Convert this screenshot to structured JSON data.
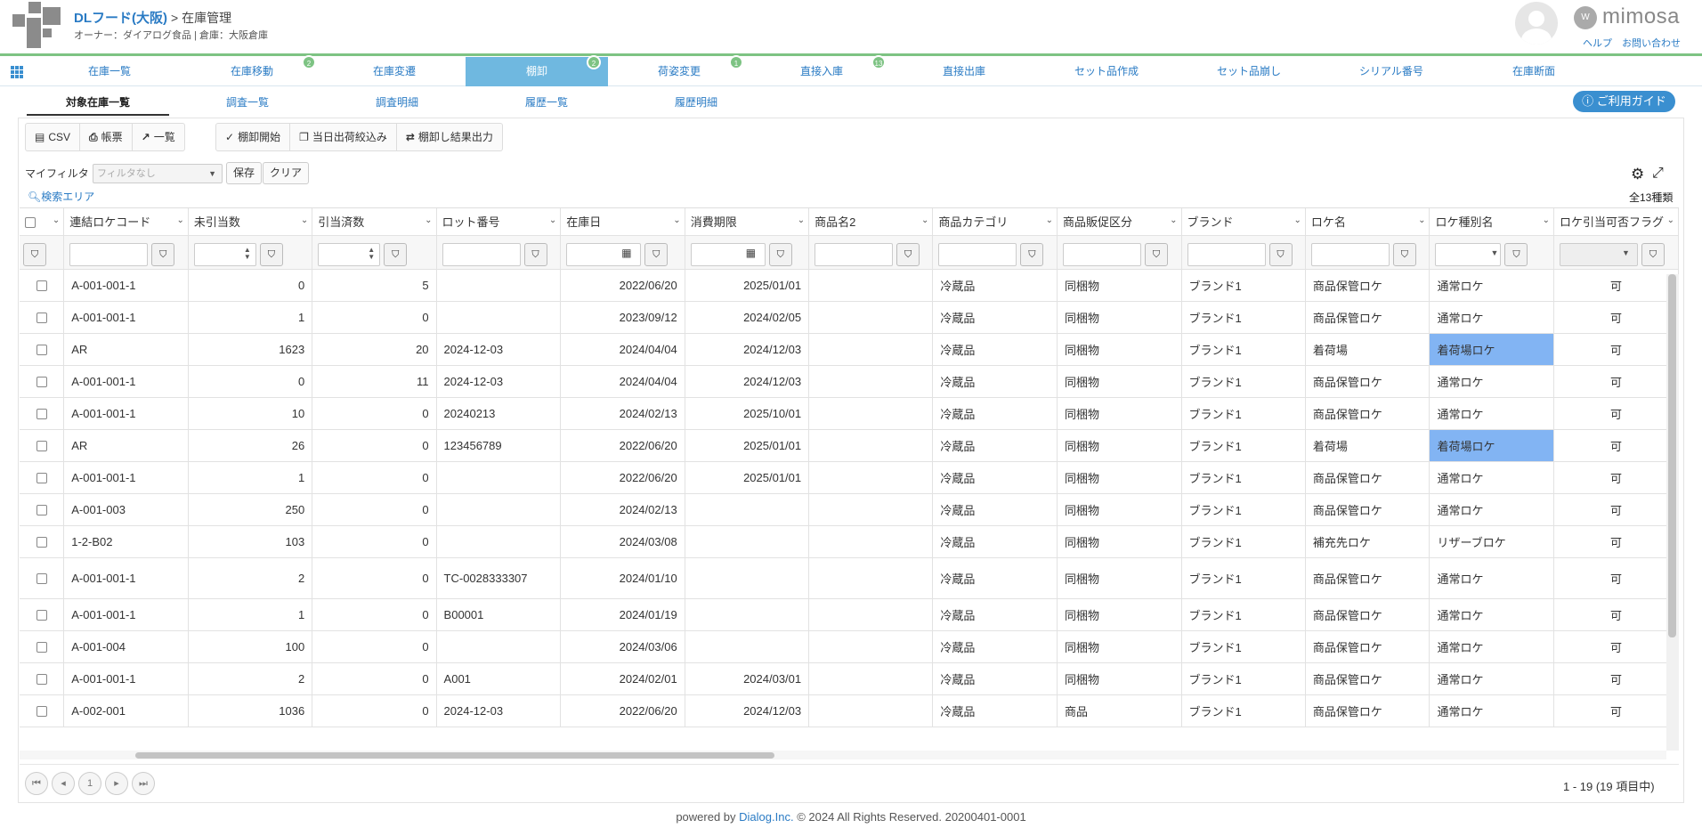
{
  "header": {
    "company": "DLフード(大阪)",
    "page": "> 在庫管理",
    "owner_line": "オーナー：ダイアログ食品 | 倉庫：大阪倉庫",
    "brand": "mimosa",
    "help": "ヘルプ",
    "contact": "お問い合わせ"
  },
  "nav": {
    "items": [
      {
        "label": "在庫一覧"
      },
      {
        "label": "在庫移動",
        "badge": "2"
      },
      {
        "label": "在庫変遷"
      },
      {
        "label": "棚卸",
        "badge": "2"
      },
      {
        "label": "荷姿変更",
        "badge": "1"
      },
      {
        "label": "直接入庫",
        "badge": "13"
      },
      {
        "label": "直接出庫"
      },
      {
        "label": "セット品作成"
      },
      {
        "label": "セット品崩し"
      },
      {
        "label": "シリアル番号"
      },
      {
        "label": "在庫断面"
      }
    ]
  },
  "subtabs": [
    "対象在庫一覧",
    "調査一覧",
    "調査明細",
    "履歴一覧",
    "履歴明細"
  ],
  "guide_button": "ご利用ガイド",
  "toolbar": {
    "csv": "CSV",
    "report": "帳票",
    "list": "一覧",
    "start": "棚卸開始",
    "narrow": "当日出荷絞込み",
    "export": "棚卸し結果出力"
  },
  "filter": {
    "label": "マイフィルタ",
    "placeholder": "フィルタなし",
    "save": "保存",
    "clear": "クリア",
    "search_area": "検索エリア",
    "total": "全13種類"
  },
  "columns": [
    "連結ロケコード",
    "未引当数",
    "引当済数",
    "ロット番号",
    "在庫日",
    "消費期限",
    "商品名2",
    "商品カテゴリ",
    "商品販促区分",
    "ブランド",
    "ロケ名",
    "ロケ種別名",
    "ロケ引当可否フラグ"
  ],
  "rows": [
    [
      "A-001-001-1",
      "0",
      "5",
      "",
      "2022/06/20",
      "2025/01/01",
      "",
      "冷蔵品",
      "同梱物",
      "ブランド1",
      "商品保管ロケ",
      "通常ロケ",
      "可"
    ],
    [
      "A-001-001-1",
      "1",
      "0",
      "",
      "2023/09/12",
      "2024/02/05",
      "",
      "冷蔵品",
      "同梱物",
      "ブランド1",
      "商品保管ロケ",
      "通常ロケ",
      "可"
    ],
    [
      "AR",
      "1623",
      "20",
      "2024-12-03",
      "2024/04/04",
      "2024/12/03",
      "",
      "冷蔵品",
      "同梱物",
      "ブランド1",
      "着荷場",
      "着荷場ロケ",
      "可"
    ],
    [
      "A-001-001-1",
      "0",
      "11",
      "2024-12-03",
      "2024/04/04",
      "2024/12/03",
      "",
      "冷蔵品",
      "同梱物",
      "ブランド1",
      "商品保管ロケ",
      "通常ロケ",
      "可"
    ],
    [
      "A-001-001-1",
      "10",
      "0",
      "20240213",
      "2024/02/13",
      "2025/10/01",
      "",
      "冷蔵品",
      "同梱物",
      "ブランド1",
      "商品保管ロケ",
      "通常ロケ",
      "可"
    ],
    [
      "AR",
      "26",
      "0",
      "123456789",
      "2022/06/20",
      "2025/01/01",
      "",
      "冷蔵品",
      "同梱物",
      "ブランド1",
      "着荷場",
      "着荷場ロケ",
      "可"
    ],
    [
      "A-001-001-1",
      "1",
      "0",
      "",
      "2022/06/20",
      "2025/01/01",
      "",
      "冷蔵品",
      "同梱物",
      "ブランド1",
      "商品保管ロケ",
      "通常ロケ",
      "可"
    ],
    [
      "A-001-003",
      "250",
      "0",
      "",
      "2024/02/13",
      "",
      "",
      "冷蔵品",
      "同梱物",
      "ブランド1",
      "商品保管ロケ",
      "通常ロケ",
      "可"
    ],
    [
      "1-2-B02",
      "103",
      "0",
      "",
      "2024/03/08",
      "",
      "",
      "冷蔵品",
      "同梱物",
      "ブランド1",
      "補充先ロケ",
      "リザーブロケ",
      "可"
    ],
    [
      "A-001-001-1",
      "2",
      "0",
      "TC-0028333307",
      "2024/01/10",
      "",
      "",
      "冷蔵品",
      "同梱物",
      "ブランド1",
      "商品保管ロケ",
      "通常ロケ",
      "可"
    ],
    [
      "A-001-001-1",
      "1",
      "0",
      "B00001",
      "2024/01/19",
      "",
      "",
      "冷蔵品",
      "同梱物",
      "ブランド1",
      "商品保管ロケ",
      "通常ロケ",
      "可"
    ],
    [
      "A-001-004",
      "100",
      "0",
      "",
      "2024/03/06",
      "",
      "",
      "冷蔵品",
      "同梱物",
      "ブランド1",
      "商品保管ロケ",
      "通常ロケ",
      "可"
    ],
    [
      "A-001-001-1",
      "2",
      "0",
      "A001",
      "2024/02/01",
      "2024/03/01",
      "",
      "冷蔵品",
      "同梱物",
      "ブランド1",
      "商品保管ロケ",
      "通常ロケ",
      "可"
    ],
    [
      "A-002-001",
      "1036",
      "0",
      "2024-12-03",
      "2022/06/20",
      "2024/12/03",
      "",
      "冷蔵品",
      "商品",
      "ブランド1",
      "商品保管ロケ",
      "通常ロケ",
      "可"
    ]
  ],
  "pager": {
    "page": "1",
    "info": "1 - 19 (19 項目中)"
  },
  "footer": {
    "prefix": "powered by",
    "link": "Dialog.Inc.",
    "suffix": "© 2024 All Rights Reserved. 20200401-0001"
  }
}
